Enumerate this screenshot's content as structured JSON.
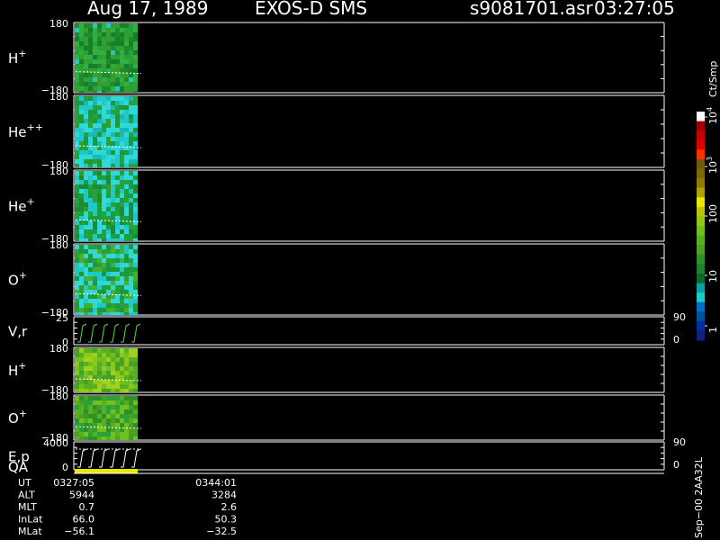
{
  "header": {
    "date": "Aug 17, 1989",
    "instrument": "EXOS-D SMS",
    "file": "s9081701.asr",
    "time": "03:27:05"
  },
  "colorbar": {
    "unit": "Ct/Smp",
    "ticks": [
      {
        "label": "10",
        "sup": "4"
      },
      {
        "label": "10",
        "sup": "3"
      },
      {
        "label": "100",
        "sup": ""
      },
      {
        "label": "10",
        "sup": ""
      },
      {
        "label": "1",
        "sup": ""
      }
    ],
    "colors": [
      "#ffffff",
      "#a00000",
      "#c80000",
      "#e00000",
      "#ff3000",
      "#6e5a10",
      "#7a6a00",
      "#8c7c00",
      "#b0a000",
      "#e8e800",
      "#b8c800",
      "#90c818",
      "#70c020",
      "#58b020",
      "#48a028",
      "#309028",
      "#208030",
      "#106828",
      "#08a0a0",
      "#20c8c8",
      "#0070c0",
      "#0050a0",
      "#0030a0",
      "#102080"
    ]
  },
  "panels": [
    {
      "id": "h-plus",
      "species": "H",
      "sup": "+",
      "ymax": "180",
      "ymin": "−180"
    },
    {
      "id": "he-plus-plus",
      "species": "He",
      "sup": "++",
      "ymax": "180",
      "ymin": "−180"
    },
    {
      "id": "he-plus",
      "species": "He",
      "sup": "+",
      "ymax": "180",
      "ymin": "−180"
    },
    {
      "id": "o-plus",
      "species": "O",
      "sup": "+",
      "ymax": "180",
      "ymin": "−180"
    },
    {
      "id": "vr",
      "species": "V,r",
      "sup": "",
      "ymax": "25",
      "ymin": "0",
      "right_top": "90",
      "right_bottom": "0"
    },
    {
      "id": "h-plus-2",
      "species": "H",
      "sup": "+",
      "ymax": "180",
      "ymin": "−180"
    },
    {
      "id": "o-plus-2",
      "species": "O",
      "sup": "+",
      "ymax": "180",
      "ymin": "−180"
    },
    {
      "id": "ep",
      "species": "E,p",
      "sup": "",
      "ymax": "4000",
      "ymin": "0",
      "right_top": "90",
      "right_bottom": "0"
    },
    {
      "id": "qa",
      "species": "QA",
      "sup": ""
    }
  ],
  "footer": {
    "labels": [
      "UT",
      "ALT",
      "MLT",
      "InLat",
      "MLat"
    ],
    "col1": [
      "0327:05",
      "5944",
      "0.7",
      "66.0",
      "−56.1"
    ],
    "col2": [
      "0344:01",
      "3284",
      "2.6",
      "50.3",
      "−32.5"
    ],
    "stamp": "Sep−00  2AA32L"
  },
  "chart_data": {
    "type": "heatmap",
    "title": "Aug 17, 1989   EXOS-D SMS",
    "x": {
      "start": "0327:05",
      "end": "0344:01"
    },
    "colorscale": {
      "label": "Ct/Smp",
      "scale": "log",
      "range": [
        1,
        10000
      ]
    },
    "panels": [
      {
        "name": "H+",
        "y_range": [
          -180,
          180
        ],
        "data_extent_fraction": 0.09
      },
      {
        "name": "He++",
        "y_range": [
          -180,
          180
        ],
        "data_extent_fraction": 0.09
      },
      {
        "name": "He+",
        "y_range": [
          -180,
          180
        ],
        "data_extent_fraction": 0.09
      },
      {
        "name": "O+",
        "y_range": [
          -180,
          180
        ],
        "data_extent_fraction": 0.09
      },
      {
        "name": "V,r",
        "y_range": [
          0,
          25
        ],
        "right_range": [
          0,
          90
        ]
      },
      {
        "name": "H+",
        "y_range": [
          -180,
          180
        ]
      },
      {
        "name": "O+",
        "y_range": [
          -180,
          180
        ]
      },
      {
        "name": "E,p",
        "y_range": [
          0,
          4000
        ],
        "right_range": [
          0,
          90
        ]
      }
    ]
  }
}
